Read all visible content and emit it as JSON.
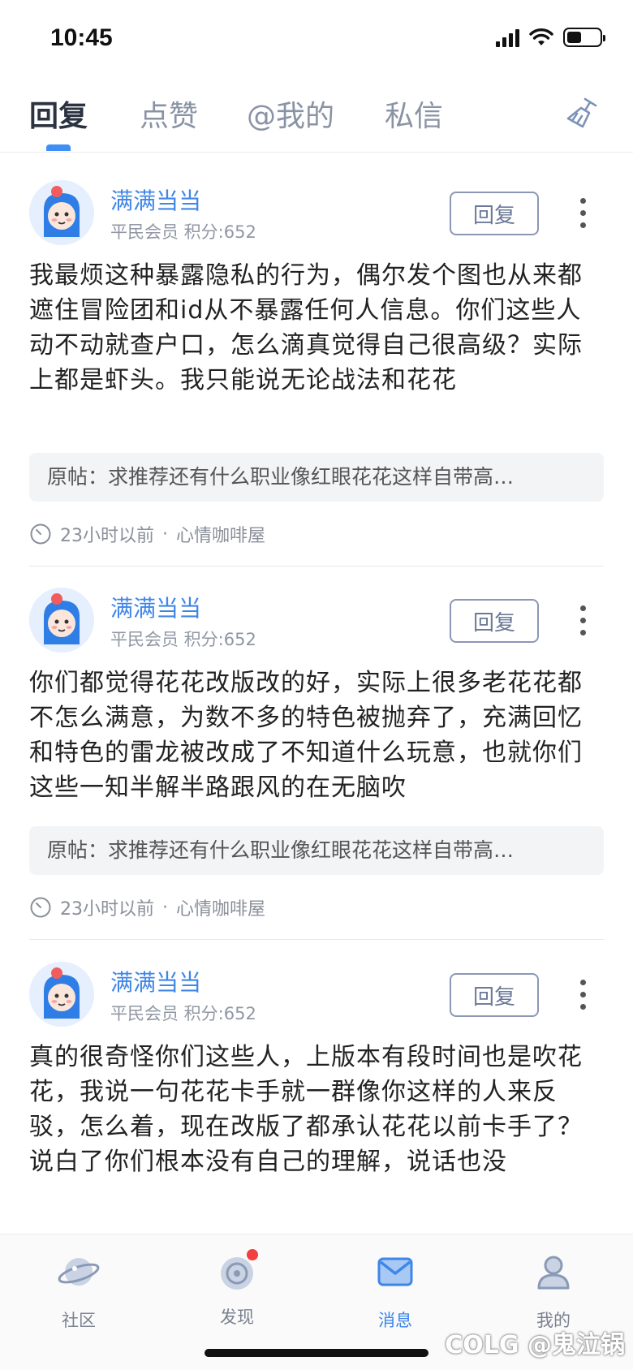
{
  "status": {
    "time": "10:45"
  },
  "tabs": [
    {
      "label": "回复",
      "active": true
    },
    {
      "label": "点赞",
      "active": false
    },
    {
      "label": "@我的",
      "active": false
    },
    {
      "label": "私信",
      "active": false
    }
  ],
  "accent_color": "#3f8ef5",
  "posts": [
    {
      "username": "满满当当",
      "meta": "平民会员 积分:652",
      "reply_label": "回复",
      "content": "我最烦这种暴露隐私的行为，偶尔发个图也从来都遮住冒险团和id从不暴露任何人信息。你们这些人动不动就查户口，怎么滴真觉得自己很高级？实际上都是虾头。我只能说无论战法和花花",
      "original": "原帖：求推荐还有什么职业像红眼花花这样自带高…",
      "time": "23小时以前",
      "board": "心情咖啡屋"
    },
    {
      "username": "满满当当",
      "meta": "平民会员 积分:652",
      "reply_label": "回复",
      "content": "你们都觉得花花改版改的好，实际上很多老花花都不怎么满意，为数不多的特色被抛弃了，充满回忆和特色的雷龙被改成了不知道什么玩意，也就你们这些一知半解半路跟风的在无脑吹",
      "original": "原帖：求推荐还有什么职业像红眼花花这样自带高…",
      "time": "23小时以前",
      "board": "心情咖啡屋"
    },
    {
      "username": "满满当当",
      "meta": "平民会员 积分:652",
      "reply_label": "回复",
      "content": "真的很奇怪你们这些人，上版本有段时间也是吹花花，我说一句花花卡手就一群像你这样的人来反驳，怎么着，现在改版了都承认花花以前卡手了？说白了你们根本没有自己的理解，说话也没"
    }
  ],
  "separator": "·",
  "nav": [
    {
      "label": "社区",
      "icon": "planet-icon",
      "active": false
    },
    {
      "label": "发现",
      "icon": "discover-icon",
      "active": false,
      "badge": true
    },
    {
      "label": "消息",
      "icon": "mail-icon",
      "active": true
    },
    {
      "label": "我的",
      "icon": "profile-icon",
      "active": false
    }
  ],
  "watermark": "COLG @鬼泣锅"
}
